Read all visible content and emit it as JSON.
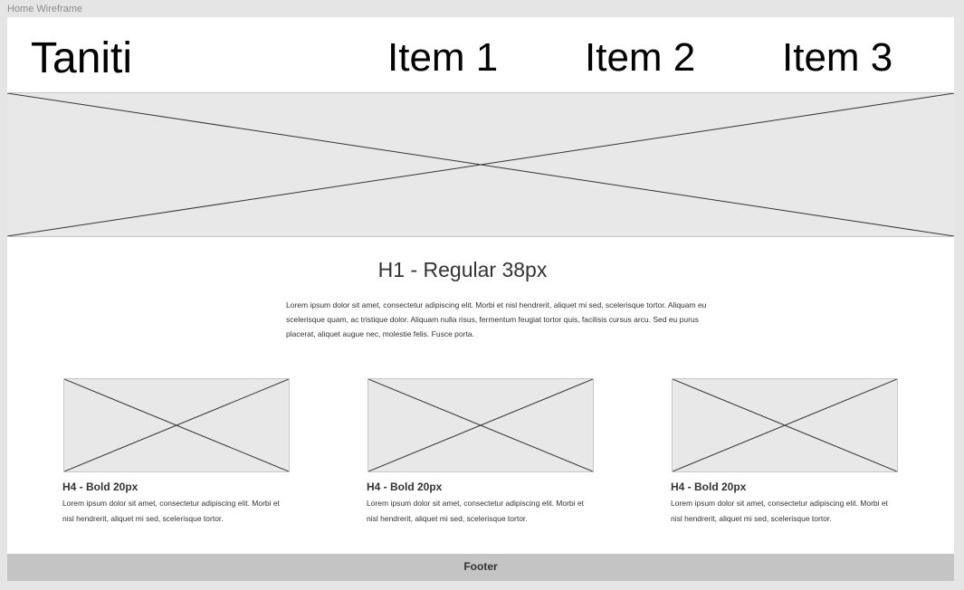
{
  "frame": {
    "label": "Home Wireframe"
  },
  "header": {
    "logo": "Taniti",
    "nav": [
      {
        "label": "Item 1"
      },
      {
        "label": "Item 2"
      },
      {
        "label": "Item 3"
      }
    ]
  },
  "hero": {
    "placeholder": "image-placeholder"
  },
  "intro": {
    "heading": "H1 - Regular 38px",
    "body": "Lorem ipsum dolor sit amet, consectetur adipiscing elit. Morbi et nisl hendrerit, aliquet mi sed, scelerisque tortor. Aliquam eu scelerisque quam, ac tristique dolor. Aliquam nulla risus, fermentum feugiat tortor quis, facilisis cursus arcu. Sed eu purus placerat, aliquet augue nec, molestie felis. Fusce porta."
  },
  "cards": [
    {
      "title": "H4 - Bold 20px",
      "text": "Lorem ipsum dolor sit amet, consectetur adipiscing elit. Morbi et nisl hendrerit, aliquet mi sed, scelerisque tortor."
    },
    {
      "title": "H4 - Bold 20px",
      "text": "Lorem ipsum dolor sit amet, consectetur adipiscing elit. Morbi et nisl hendrerit, aliquet mi sed, scelerisque tortor."
    },
    {
      "title": "H4 - Bold 20px",
      "text": "Lorem ipsum dolor sit amet, consectetur adipiscing elit. Morbi et nisl hendrerit, aliquet mi sed, scelerisque tortor."
    }
  ],
  "footer": {
    "label": "Footer"
  },
  "colors": {
    "canvas": "#e5e5e5",
    "frame": "#ffffff",
    "placeholder_fill": "#e8e8e8",
    "footer": "#c4c4c4"
  }
}
